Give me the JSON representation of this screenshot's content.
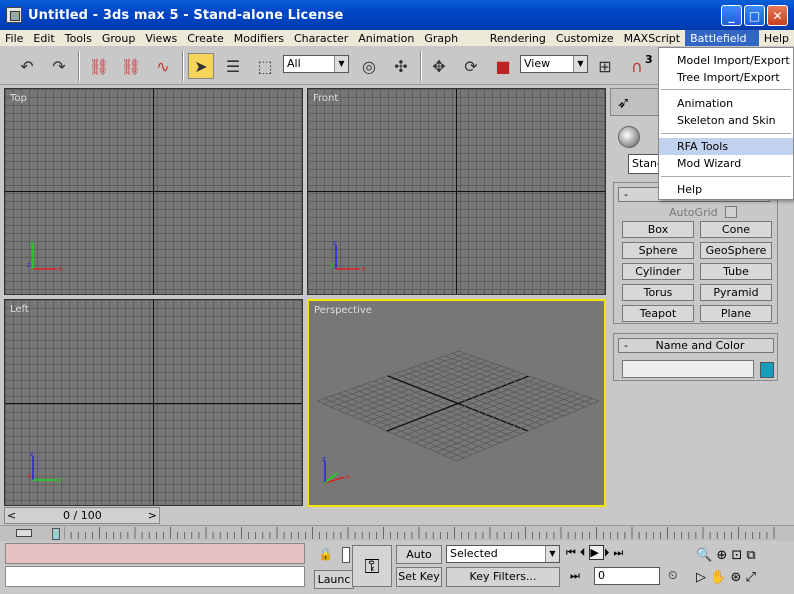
{
  "window": {
    "title": "Untitled - 3ds max 5 - Stand-alone License"
  },
  "menu": [
    "File",
    "Edit",
    "Tools",
    "Group",
    "Views",
    "Create",
    "Modifiers",
    "Character",
    "Animation",
    "Graph Editors",
    "Rendering",
    "Customize",
    "MAXScript",
    "Battlefield Tools",
    "Help"
  ],
  "toolbar": {
    "selection_filter": "All",
    "ref_coord": "View",
    "snap_count": "3"
  },
  "battlefield_menu": {
    "items": [
      "Model Import/Export",
      "Tree Import/Export",
      "Animation",
      "Skeleton and Skin",
      "RFA Tools",
      "Mod Wizard",
      "Help"
    ],
    "highlighted": "RFA Tools"
  },
  "viewports": {
    "top": "Top",
    "front": "Front",
    "left": "Left",
    "perspective": "Perspective"
  },
  "command_panel": {
    "dropdown": "Stand",
    "object_type_minus": "-",
    "autogrid": "AutoGrid",
    "buttons": [
      "Box",
      "Cone",
      "Sphere",
      "GeoSphere",
      "Cylinder",
      "Tube",
      "Torus",
      "Pyramid",
      "Teapot",
      "Plane"
    ],
    "name_color_header": "Name and Color",
    "name_color_minus": "-"
  },
  "timeline": {
    "frame": "0 / 100",
    "prev": "<",
    "next": ">"
  },
  "status": {
    "launch": "Launc",
    "auto_key": "Auto Key",
    "set_key": "Set Key",
    "selected": "Selected",
    "key_filters": "Key Filters...",
    "frame_value": "0"
  },
  "colors": {
    "active_viewport": "#f2e400",
    "object_color": "#1a9cbd",
    "status_pink": "#e6c2c2",
    "menu_highlight": "#c1d2ee"
  }
}
